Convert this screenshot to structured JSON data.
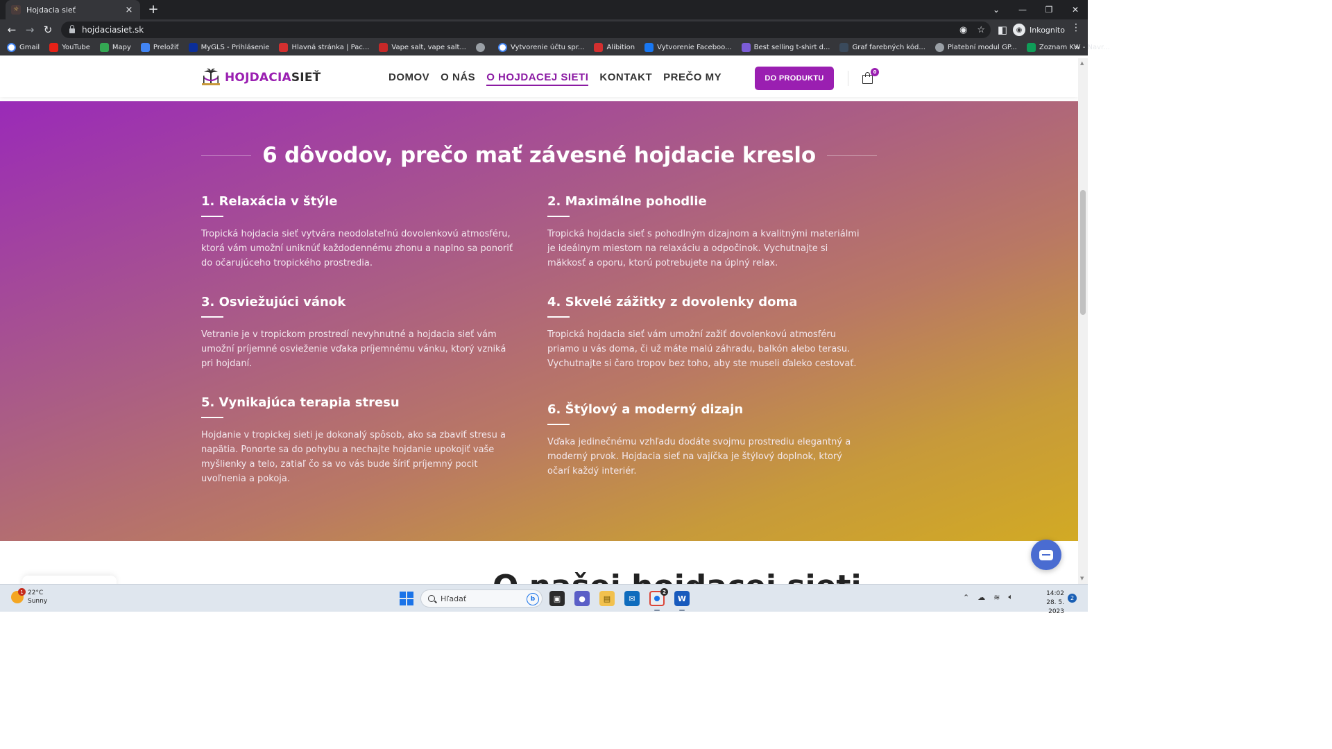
{
  "browser": {
    "tab_title": "Hojdacia sieť",
    "tab_close": "×",
    "new_tab": "+",
    "url": "hojdaciasiet.sk",
    "profile_label": "Inkognito",
    "bookmarks": [
      {
        "label": "Gmail",
        "icon": "google-icon",
        "color": "#ffffff"
      },
      {
        "label": "YouTube",
        "icon": "youtube-icon",
        "color": "#e62117"
      },
      {
        "label": "Mapy",
        "icon": "maps-icon",
        "color": "#34a853"
      },
      {
        "label": "Preložiť",
        "icon": "translate-icon",
        "color": "#4285f4"
      },
      {
        "label": "MyGLS - Prihlásenie",
        "icon": "gls-icon",
        "color": "#0b2e99"
      },
      {
        "label": "Hlavná stránka | Pac...",
        "icon": "shield-red-icon",
        "color": "#d32f2f"
      },
      {
        "label": "Vape salt, vape salt...",
        "icon": "vape-icon",
        "color": "#c62828"
      },
      {
        "label": "",
        "icon": "globe-icon",
        "color": "#9aa0a6"
      },
      {
        "label": "Vytvorenie účtu spr...",
        "icon": "google-icon",
        "color": "#ffffff"
      },
      {
        "label": "Alibition",
        "icon": "shield-red-icon",
        "color": "#d32f2f"
      },
      {
        "label": "Vytvorenie Faceboo...",
        "icon": "diamond-icon",
        "color": "#1877f2"
      },
      {
        "label": "Best selling t-shirt d...",
        "icon": "star-badge-icon",
        "color": "#7b5cd6"
      },
      {
        "label": "Graf farebných kód...",
        "icon": "rt-icon",
        "color": "#3a4a5c"
      },
      {
        "label": "Platební modul GP...",
        "icon": "globe-icon",
        "color": "#9aa0a6"
      },
      {
        "label": "Zoznam KW - Navr...",
        "icon": "sheets-icon",
        "color": "#0f9d58"
      }
    ],
    "bookmarks_more": "»"
  },
  "site": {
    "logo_part1": "HOJDACIA",
    "logo_part2": "SIEŤ",
    "nav": [
      "DOMOV",
      "O NÁS",
      "O HOJDACEJ SIETI",
      "KONTAKT",
      "PREČO MY"
    ],
    "active_nav_index": 2,
    "cta_label": "DO PRODUKTU",
    "cart_count": "0",
    "brand_color": "#9a1fb1"
  },
  "hero": {
    "title": "6 dôvodov, prečo mať závesné hojdacie kreslo",
    "features": [
      {
        "title": "1. Relaxácia v štýle",
        "text": "Tropická hojdacia sieť vytvára neodolateľnú dovolenkovú atmosféru, ktorá vám umožní uniknúť každodennému zhonu a naplno sa ponoriť do očarujúceho tropického prostredia."
      },
      {
        "title": "2. Maximálne pohodlie",
        "text": "Tropická hojdacia sieť s pohodlným dizajnom a kvalitnými materiálmi je ideálnym miestom na relaxáciu a odpočinok. Vychutnajte si mäkkosť a oporu, ktorú potrebujete na úplný relax."
      },
      {
        "title": "3. Osviežujúci vánok",
        "text": "Vetranie je v tropickom prostredí nevyhnutné a hojdacia sieť vám umožní príjemné osvieženie vďaka príjemnému vánku, ktorý vzniká pri hojdaní."
      },
      {
        "title": "4. Skvelé zážitky z dovolenky doma",
        "text": "Tropická hojdacia sieť vám umožní zažiť dovolenkovú atmosféru priamo u vás doma, či už máte malú záhradu, balkón alebo terasu. Vychutnajte si čaro tropov bez toho, aby ste museli ďaleko cestovať."
      },
      {
        "title": "5. Vynikajúca terapia stresu",
        "text": "Hojdanie v tropickej sieti je dokonalý spôsob, ako sa zbaviť stresu a napätia. Ponorte sa do pohybu a nechajte hojdanie upokojiť vaše myšlienky a telo, zatiaľ čo sa vo vás bude šíriť príjemný pocit uvoľnenia a pokoja."
      },
      {
        "title": "6. Štýlový a moderný dizajn",
        "text": "Vďaka jedinečnému vzhľadu dodáte svojmu prostrediu elegantný a moderný prvok. Hojdacia sieť na vajíčka je štýlový doplnok, ktorý očarí každý interiér."
      }
    ]
  },
  "next_section": {
    "heading": "O našej hojdacej sieti"
  },
  "taskbar": {
    "temperature": "22°C",
    "weather": "Sunny",
    "weather_badge": "1",
    "search_placeholder": "Hľadať",
    "time": "14:02",
    "date": "28. 5. 2023",
    "notifications": "2",
    "chrome_badge": "2"
  }
}
